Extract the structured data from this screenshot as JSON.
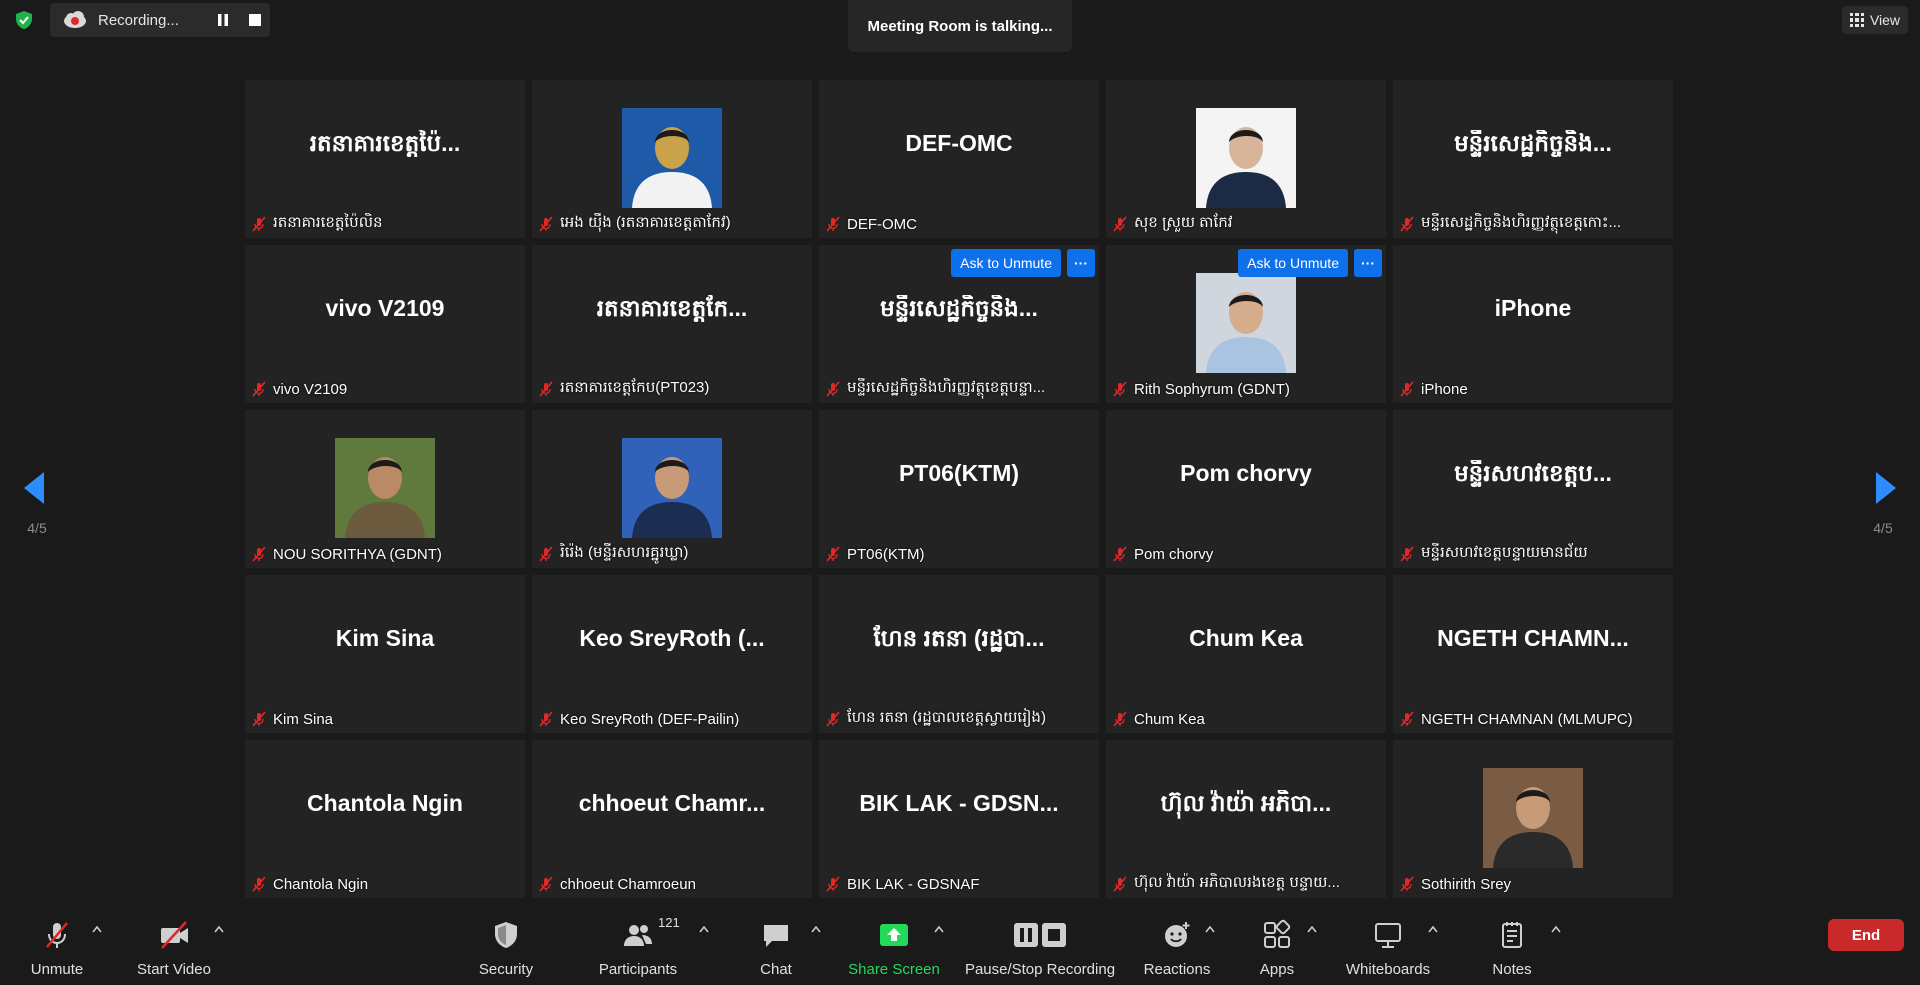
{
  "top": {
    "recording_label": "Recording...",
    "talking": "Meeting Room is talking...",
    "view_label": "View"
  },
  "pagination": {
    "left": "4/5",
    "right": "4/5"
  },
  "tiles": [
    {
      "display": "រតនាគារខេត្តប៉ៃ...",
      "name": "រតនាគារខេត្តប៉ៃលិន"
    },
    {
      "display": "",
      "name": "អេង យ៉ឹង (រតនាគារខេត្តតាកែវ)",
      "avatar": "profile-photo-badge"
    },
    {
      "display": "DEF-OMC",
      "name": "DEF-OMC"
    },
    {
      "display": "",
      "name": "សុខ ស្រួយ តាកែវ",
      "avatar": "profile-photo-suit"
    },
    {
      "display": "មន្ទីរសេដ្ឋកិច្ចនិង...",
      "name": "មន្ទីរសេដ្ឋកិច្ចនិងហិរញ្ញវត្ថុខេត្តកោះ..."
    },
    {
      "display": "vivo V2109",
      "name": "vivo V2109"
    },
    {
      "display": "រតនាគារខេត្តកែ...",
      "name": "រតនាគារខេត្តកែប(PT023)"
    },
    {
      "display": "មន្ទីរសេដ្ឋកិច្ចនិង...",
      "name": "មន្ទីរសេដ្ឋកិច្ចនិងហិរញ្ញវត្ថុខេត្តបន្ទា...",
      "ask": true
    },
    {
      "display": "",
      "name": "Rith Sophyrum (GDNT)",
      "avatar": "profile-photo-shirt",
      "ask": true
    },
    {
      "display": "iPhone",
      "name": "iPhone"
    },
    {
      "display": "",
      "name": "NOU SORITHYA (GDNT)",
      "avatar": "profile-photo-outdoor"
    },
    {
      "display": "",
      "name": "រិរ៉េង (មន្ទីរសហរគ្នូរឃ្លា)",
      "avatar": "profile-photo-blue"
    },
    {
      "display": "PT06(KTM)",
      "name": "PT06(KTM)"
    },
    {
      "display": "Pom chorvy",
      "name": "Pom chorvy"
    },
    {
      "display": "មន្ទីរសហវខេត្តប...",
      "name": "មន្ទីរសហវខេត្តបន្ទាយមានជ័យ"
    },
    {
      "display": "Kim Sina",
      "name": "Kim Sina"
    },
    {
      "display": "Keo SreyRoth (...",
      "name": "Keo SreyRoth (DEF-Pailin)"
    },
    {
      "display": "ហែន រតនា (រដ្ឋបា...",
      "name": "ហែន រតនា (រដ្ឋបាលខេត្តស្វាយរៀង)"
    },
    {
      "display": "Chum Kea",
      "name": "Chum Kea"
    },
    {
      "display": "NGETH CHAMN...",
      "name": "NGETH CHAMNAN (MLMUPC)"
    },
    {
      "display": "Chantola Ngin",
      "name": "Chantola Ngin"
    },
    {
      "display": "chhoeut Chamr...",
      "name": "chhoeut Chamroeun"
    },
    {
      "display": "BIK LAK - GDSN...",
      "name": "BIK LAK - GDSNAF"
    },
    {
      "display": "ហ៊ុល វ៉ាយ៉ា អភិបា...",
      "name": "ហ៊ុល វ៉ាយ៉ា អភិបាលរងខេត្ត បន្ទាយ..."
    },
    {
      "display": "",
      "name": "Sothirith Srey",
      "avatar": "profile-photo-jacket"
    }
  ],
  "ask_to_unmute_label": "Ask to Unmute",
  "more_label": "···",
  "toolbar": {
    "unmute": "Unmute",
    "start_video": "Start Video",
    "security": "Security",
    "participants": "Participants",
    "participants_count": "121",
    "chat": "Chat",
    "share_screen": "Share Screen",
    "pause_stop": "Pause/Stop Recording",
    "reactions": "Reactions",
    "apps": "Apps",
    "whiteboards": "Whiteboards",
    "notes": "Notes",
    "end": "End"
  },
  "colors": {
    "accent": "#0e71eb",
    "share_green": "#23d959",
    "end_red": "#c8292b",
    "mute_red": "#e02828",
    "arrow_blue": "#2d8cff"
  }
}
